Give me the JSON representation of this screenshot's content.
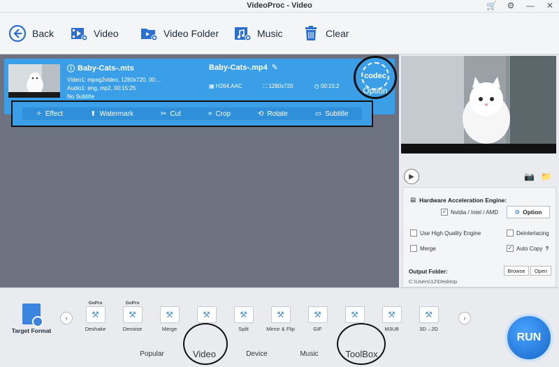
{
  "window": {
    "title": "VideoProc - Video"
  },
  "toolbar": {
    "back": "Back",
    "video": "Video",
    "video_folder": "Video Folder",
    "music": "Music",
    "clear": "Clear"
  },
  "file": {
    "source_name": "Baby-Cats-.mts",
    "video_line": "Video1: mpeg2video, 1280x720, 00:...",
    "audio_line": "Audio1: eng, mp2, 00:15:25",
    "subtitle_line": "No Subtitle",
    "output_name": "Baby-Cats-.mp4",
    "codec": "H264,AAC",
    "resolution": "1280x720",
    "duration": "00:15:2",
    "codec_badge": "codec",
    "codec_option": "Option"
  },
  "edit_bar": {
    "effect": "Effect",
    "watermark": "Watermark",
    "cut": "Cut",
    "crop": "Crop",
    "rotate": "Rotate",
    "subtitle": "Subtitle"
  },
  "settings": {
    "hw_title": "Hardware Acceleration Engine:",
    "nvidia": "Nvidia / Intel / AMD",
    "option_btn": "Option",
    "high_quality": "Use High Quality Engine",
    "deinterlacing": "Deinterlacing",
    "merge": "Merge",
    "auto_copy": "Auto Copy",
    "output_folder_label": "Output Folder:",
    "output_path": "C:\\Users\\12\\Desktop",
    "browse": "Browse",
    "open": "Open"
  },
  "bottom": {
    "target_format": "Target Format",
    "formats": [
      {
        "brand": "GoPro",
        "label": "Deshake"
      },
      {
        "brand": "GoPro",
        "label": "Denoise"
      },
      {
        "brand": "",
        "label": "Merge"
      },
      {
        "brand": "",
        "label": ""
      },
      {
        "brand": "",
        "label": "Split"
      },
      {
        "brand": "",
        "label": "Mirror & Flip"
      },
      {
        "brand": "",
        "label": "GIF"
      },
      {
        "brand": "",
        "label": ""
      },
      {
        "brand": "",
        "label": "M3U8"
      },
      {
        "brand": "",
        "label": "3D→2D"
      }
    ],
    "tabs": [
      "Popular",
      "Video",
      "Device",
      "Music",
      "ToolBox"
    ],
    "run": "RUN"
  }
}
